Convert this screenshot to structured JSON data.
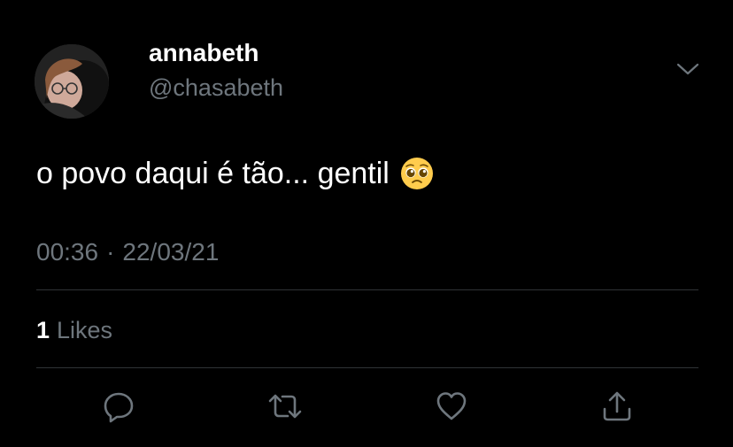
{
  "user": {
    "display_name": "annabeth",
    "handle": "@chasabeth",
    "avatar_icon": "profile-photo"
  },
  "tweet": {
    "text": "o povo daqui é tão... gentil",
    "emoji": "pleading-face-emoji",
    "time": "00:36",
    "separator": "·",
    "date": "22/03/21"
  },
  "stats": {
    "likes_count": "1",
    "likes_label": "Likes"
  },
  "actions": {
    "reply_icon": "reply-icon",
    "retweet_icon": "retweet-icon",
    "like_icon": "heart-icon",
    "share_icon": "share-icon",
    "menu_icon": "chevron-down-icon"
  },
  "colors": {
    "background": "#000000",
    "primary_text": "#ffffff",
    "secondary_text": "#6e767d",
    "divider": "#2f3336"
  }
}
